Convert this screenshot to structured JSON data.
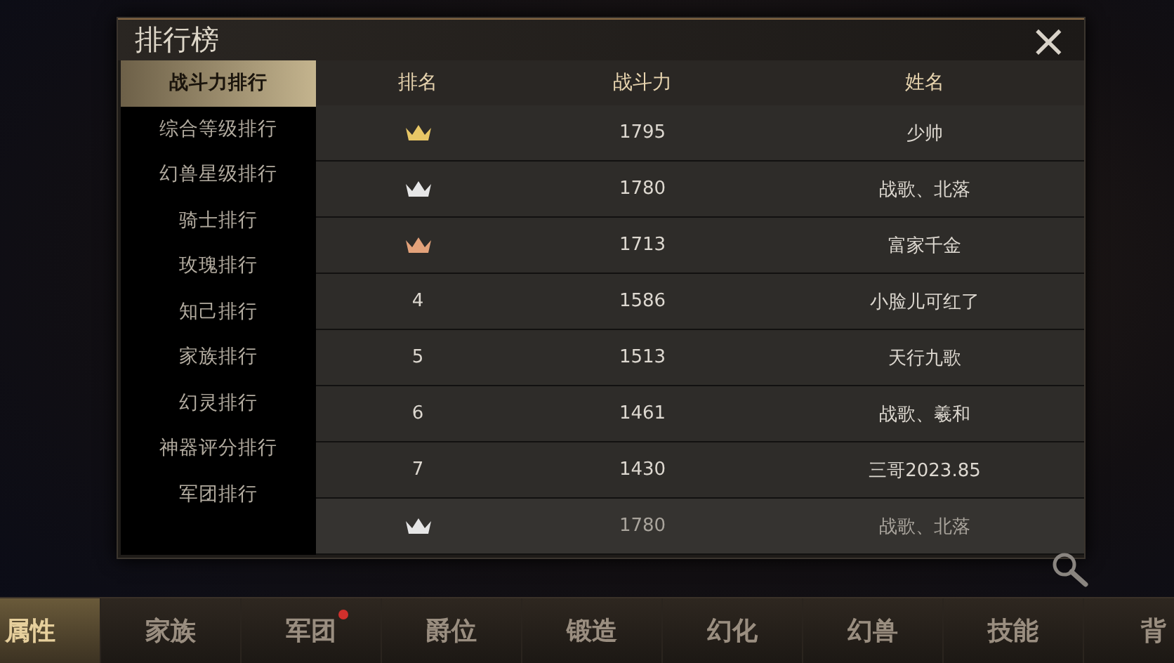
{
  "dialog": {
    "title": "排行榜",
    "close": "×"
  },
  "sidebar": {
    "items": [
      {
        "label": "战斗力排行",
        "selected": true
      },
      {
        "label": "综合等级排行",
        "selected": false
      },
      {
        "label": "幻兽星级排行",
        "selected": false
      },
      {
        "label": "骑士排行",
        "selected": false
      },
      {
        "label": "玫瑰排行",
        "selected": false
      },
      {
        "label": "知己排行",
        "selected": false
      },
      {
        "label": "家族排行",
        "selected": false
      },
      {
        "label": "幻灵排行",
        "selected": false
      },
      {
        "label": "神器评分排行",
        "selected": false
      },
      {
        "label": "军团排行",
        "selected": false
      }
    ]
  },
  "table": {
    "columns": [
      "排名",
      "战斗力",
      "姓名"
    ],
    "rows": [
      {
        "rank": {
          "kind": "crown",
          "color": "#e8c766"
        },
        "power": "1795",
        "name": "少帅",
        "faded": false
      },
      {
        "rank": {
          "kind": "crown",
          "color": "#e6e6e6"
        },
        "power": "1780",
        "name": "战歌、北落",
        "faded": false
      },
      {
        "rank": {
          "kind": "crown",
          "color": "#e3a27a"
        },
        "power": "1713",
        "name": "富家千金",
        "faded": false
      },
      {
        "rank": {
          "kind": "number",
          "text": "4"
        },
        "power": "1586",
        "name": "小脸儿可红了",
        "faded": false
      },
      {
        "rank": {
          "kind": "number",
          "text": "5"
        },
        "power": "1513",
        "name": "天行九歌",
        "faded": false
      },
      {
        "rank": {
          "kind": "number",
          "text": "6"
        },
        "power": "1461",
        "name": "战歌、羲和",
        "faded": false
      },
      {
        "rank": {
          "kind": "number",
          "text": "7"
        },
        "power": "1430",
        "name": "三哥2023.85",
        "faded": false
      },
      {
        "rank": {
          "kind": "crown",
          "color": "#e6e6e6"
        },
        "power": "1780",
        "name": "战歌、北落",
        "faded": true
      }
    ]
  },
  "bottom_nav": [
    {
      "label": "属性",
      "selected": true,
      "badge": false
    },
    {
      "label": "家族",
      "selected": false,
      "badge": false
    },
    {
      "label": "军团",
      "selected": false,
      "badge": true
    },
    {
      "label": "爵位",
      "selected": false,
      "badge": false
    },
    {
      "label": "锻造",
      "selected": false,
      "badge": false
    },
    {
      "label": "幻化",
      "selected": false,
      "badge": false
    },
    {
      "label": "幻兽",
      "selected": false,
      "badge": false
    },
    {
      "label": "技能",
      "selected": false,
      "badge": false
    },
    {
      "label": "背",
      "selected": false,
      "badge": false
    }
  ]
}
